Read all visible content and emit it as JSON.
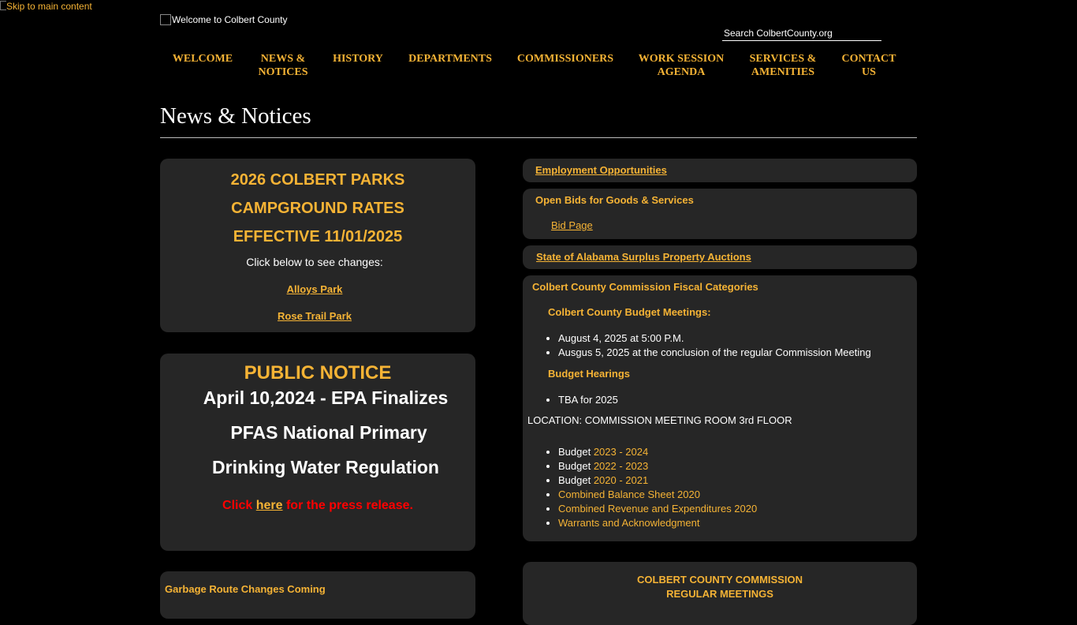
{
  "skip_link": "Skip to main content",
  "logo_alt": "Welcome to Colbert County",
  "search": {
    "placeholder": "Search ColbertCounty.org"
  },
  "nav": [
    {
      "line1": "WELCOME",
      "line2": ""
    },
    {
      "line1": "NEWS &",
      "line2": "NOTICES"
    },
    {
      "line1": "HISTORY",
      "line2": ""
    },
    {
      "line1": "DEPARTMENTS",
      "line2": ""
    },
    {
      "line1": "COMMISSIONERS",
      "line2": ""
    },
    {
      "line1": "WORK SESSION",
      "line2": "AGENDA"
    },
    {
      "line1": "SERVICES &",
      "line2": "AMENITIES"
    },
    {
      "line1": "CONTACT",
      "line2": "US"
    }
  ],
  "page_title": "News & Notices",
  "parks": {
    "line1": "2026 COLBERT PARKS",
    "line2": "CAMPGROUND RATES",
    "line3": "EFFECTIVE 11/01/2025",
    "sub": "Click below to see changes:",
    "link1": "Alloys Park",
    "link2": "Rose Trail Park"
  },
  "notice": {
    "heading": "PUBLIC NOTICE",
    "line1": "April 10,2024 - EPA Finalizes",
    "line2": "PFAS National Primary",
    "line3": "Drinking Water Regulation",
    "click_pre": "Click ",
    "click_link": "here",
    "click_post": " for the press release."
  },
  "garbage": {
    "title": "Garbage Route Changes Coming"
  },
  "employment": {
    "link": "Employment Opportunities"
  },
  "bids": {
    "title": "Open Bids for Goods & Services",
    "link": "Bid Page"
  },
  "surplus": {
    "link": "State of Alabama Surplus Property Auctions"
  },
  "fiscal": {
    "title": "Colbert County Commission Fiscal Categories",
    "budget_meetings_title": "Colbert County Budget Meetings:",
    "meetings": [
      "August 4, 2025 at 5:00 P.M.",
      "Ausgus 5, 2025 at the conclusion of the regular Commission Meeting"
    ],
    "hearings_title": "Budget Hearings",
    "hearings": [
      "TBA for 2025"
    ],
    "location": "LOCATION: COMMISSION MEETING ROOM 3rd FLOOR",
    "budget_word": "Budget ",
    "budgets": [
      "2023 - 2024",
      "2022 - 2023",
      "2020 - 2021"
    ],
    "links": [
      "Combined Balance Sheet 2020",
      "Combined Revenue and Expenditures 2020",
      "Warrants and Acknowledgment"
    ]
  },
  "regular": {
    "line1": "COLBERT COUNTY COMMISSION",
    "line2": "REGULAR MEETINGS"
  },
  "colors": {
    "accent": "#f5b335",
    "card": "#262626",
    "alert": "#ff0000"
  }
}
